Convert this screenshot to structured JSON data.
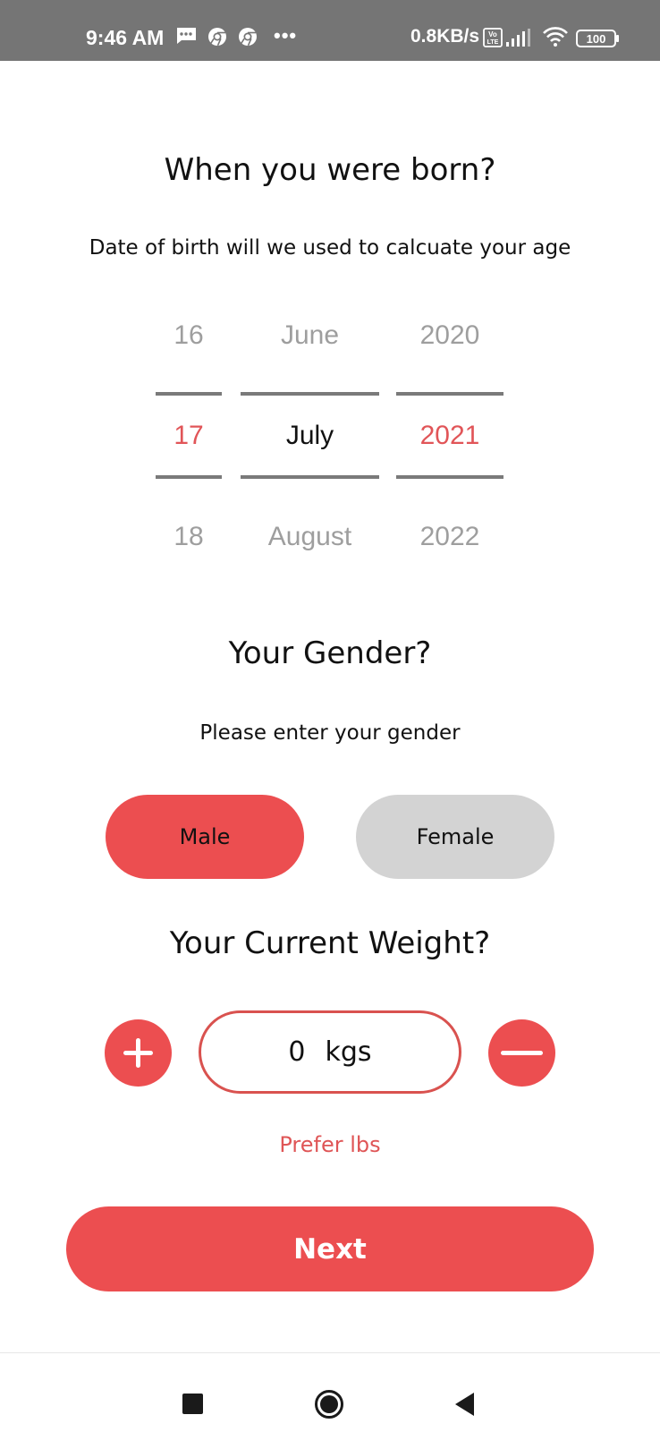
{
  "status_bar": {
    "time": "9:46 AM",
    "more_dots": "•••",
    "network_speed": "0.8KB/s",
    "volte_label": "Vo LTE",
    "battery_level": "100",
    "icons": [
      "message-icon",
      "chrome-icon",
      "chrome-icon",
      "more-icon",
      "volte-icon",
      "signal-icon",
      "wifi-icon",
      "battery-icon"
    ]
  },
  "birth": {
    "title": "When you were born?",
    "subtitle": "Date of birth will we used to calcuate your age",
    "day": {
      "prev": "16",
      "selected": "17",
      "next": "18"
    },
    "month": {
      "prev": "June",
      "selected": "July",
      "next": "August"
    },
    "year": {
      "prev": "2020",
      "selected": "2021",
      "next": "2022"
    }
  },
  "gender": {
    "title": "Your Gender?",
    "subtitle": "Please enter your gender",
    "options": [
      "Male",
      "Female"
    ],
    "selected": "Male"
  },
  "weight": {
    "title": "Your Current Weight?",
    "value": "0",
    "unit": "kgs",
    "prefer_label": "Prefer lbs"
  },
  "next_label": "Next",
  "colors": {
    "accent": "#ec4e50",
    "unselected": "#d3d3d3",
    "status_bar": "#757575",
    "muted_text": "#9e9e9e"
  },
  "nav_bar": {
    "icons": [
      "recents-icon",
      "home-icon",
      "back-icon"
    ]
  }
}
